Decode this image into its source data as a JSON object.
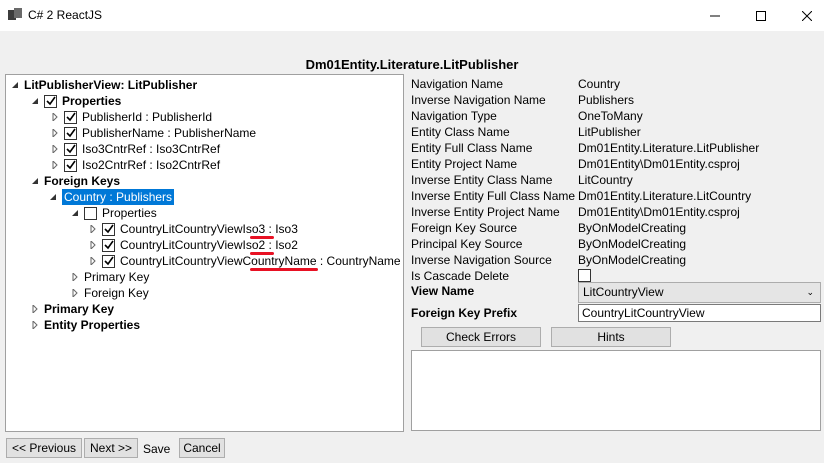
{
  "window": {
    "title": "C# 2 ReactJS"
  },
  "header": {
    "title": "Dm01Entity.Literature.LitPublisher"
  },
  "tree": {
    "root": "LitPublisherView: LitPublisher",
    "properties": "Properties",
    "prop_items": [
      "PublisherId : PublisherId",
      "PublisherName : PublisherName",
      "Iso3CntrRef : Iso3CntrRef",
      "Iso2CntrRef : Iso2CntrRef"
    ],
    "foreign_keys": "Foreign Keys",
    "fk_selected": "Country : Publishers",
    "fk_properties": "Properties",
    "fk_prop_items": [
      {
        "prefix": "CountryLitCountryView",
        "highlight": "Iso3",
        "suffix": " : Iso3"
      },
      {
        "prefix": "CountryLitCountryView",
        "highlight": "Iso2",
        "suffix": " : Iso2"
      },
      {
        "prefix": "CountryLitCountryView",
        "highlight": "CountryName",
        "suffix": " : CountryName"
      }
    ],
    "fk_primary_key": "Primary Key",
    "fk_foreign_key": "Foreign Key",
    "primary_key": "Primary Key",
    "entity_properties": "Entity Properties"
  },
  "props": [
    {
      "label": "Navigation Name",
      "value": "Country"
    },
    {
      "label": "Inverse Navigation Name",
      "value": "Publishers"
    },
    {
      "label": "Navigation Type",
      "value": "OneToMany"
    },
    {
      "label": "Entity Class Name",
      "value": "LitPublisher"
    },
    {
      "label": "Entity Full Class Name",
      "value": "Dm01Entity.Literature.LitPublisher"
    },
    {
      "label": "Entity Project Name",
      "value": "Dm01Entity\\Dm01Entity.csproj"
    },
    {
      "label": "Inverse Entity Class Name",
      "value": "LitCountry"
    },
    {
      "label": "Inverse Entity Full Class Name",
      "value": "Dm01Entity.Literature.LitCountry"
    },
    {
      "label": "Inverse Entity Project Name",
      "value": "Dm01Entity\\Dm01Entity.csproj"
    },
    {
      "label": "Foreign Key Source",
      "value": "ByOnModelCreating"
    },
    {
      "label": "Principal Key Source",
      "value": "ByOnModelCreating"
    },
    {
      "label": "Inverse Navigation Source",
      "value": "ByOnModelCreating"
    },
    {
      "label": "Is Cascade Delete",
      "value": ""
    }
  ],
  "form": {
    "view_name_label": "View Name",
    "view_name_value": "LitCountryView",
    "fk_prefix_label": "Foreign Key Prefix",
    "fk_prefix_value": "CountryLitCountryView"
  },
  "buttons": {
    "check_errors": "Check Errors",
    "hints": "Hints",
    "previous": "<< Previous",
    "next": "Next >>",
    "save": "Save",
    "cancel": "Cancel"
  },
  "colors": {
    "selection": "#0078d7",
    "underline": "#e81123"
  }
}
